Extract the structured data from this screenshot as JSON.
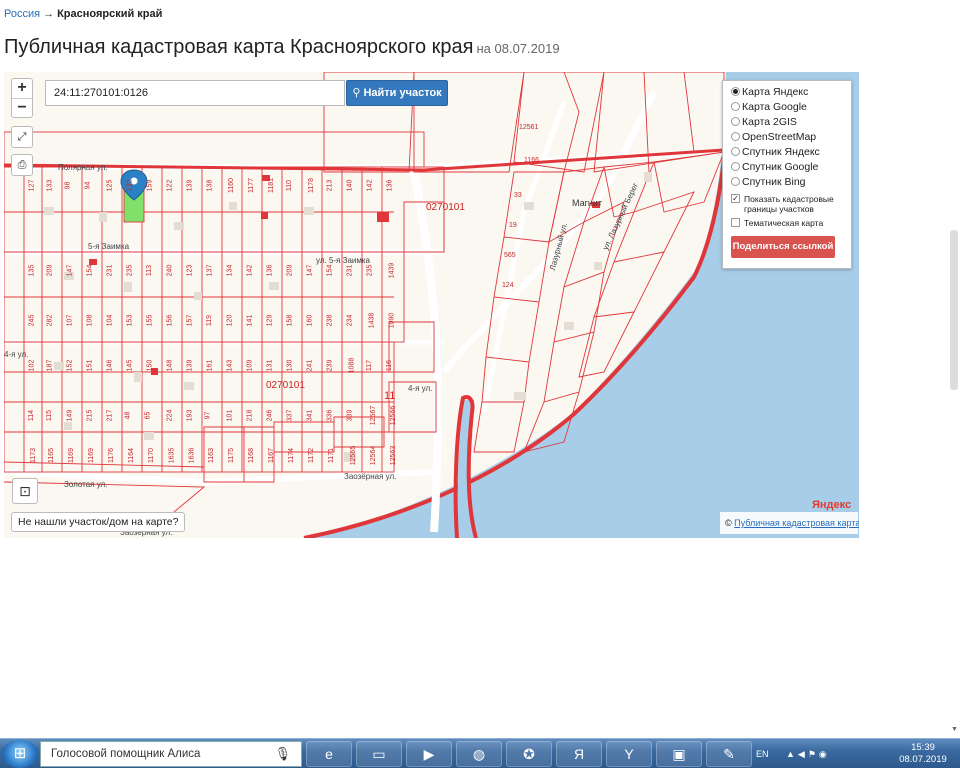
{
  "breadcrumb": {
    "root": "Россия",
    "arrow": "→",
    "current": "Красноярский край"
  },
  "page": {
    "title": "Публичная кадастровая карта Красноярского края",
    "date": "на 08.07.2019"
  },
  "map": {
    "zoom_in": "+",
    "zoom_out": "−",
    "fullscreen_icon": "expand-icon",
    "print_icon": "printer-icon",
    "search": {
      "value": "24:11:270101:0126",
      "button": "Найти участок"
    },
    "layers": [
      {
        "label": "Карта Яндекс",
        "selected": true
      },
      {
        "label": "Карта Google",
        "selected": false
      },
      {
        "label": "Карта 2GIS",
        "selected": false
      },
      {
        "label": "OpenStreetMap",
        "selected": false
      },
      {
        "label": "Спутник Яндекс",
        "selected": false
      },
      {
        "label": "Спутник Google",
        "selected": false
      },
      {
        "label": "Спутник Bing",
        "selected": false
      }
    ],
    "options": [
      {
        "label": "Показать кадастровые границы участков",
        "checked": true
      },
      {
        "label": "Тематическая карта",
        "checked": false
      }
    ],
    "share_button": "Поделиться ссылкой",
    "not_found": "Не нашли участок/дом на карте?",
    "attribution": {
      "prefix": "©",
      "link": "Публичная кадастровая карта"
    },
    "yandex_logo": "Яндекс",
    "labels": {
      "quarter1": "0270101",
      "quarter2": "0270101",
      "street_polyarnaya": "Полярная ул.",
      "street_zaimka5": "5-я Заимка",
      "street_zaimka5b": "ул. 5-я Заимка",
      "street_4ya": "4-я ул.",
      "street_4ya_b": "4-я ул.",
      "street_zaozernaya": "Заозёрная ул.",
      "street_zolotaya": "Золотая ул.",
      "street_zaozernaya_b": "Заозёрная ул.",
      "street_lazurnaya": "Лазурный ул.",
      "street_lazurny_bereg": "ул. Лазурный Берег",
      "magnit": "Магнит",
      "n11": "11"
    },
    "parcel_numbers": [
      "127",
      "133",
      "98",
      "94",
      "125",
      "132",
      "159",
      "122",
      "139",
      "138",
      "1160",
      "1177",
      "1181",
      "110",
      "1178",
      "213",
      "140",
      "142",
      "136",
      "135",
      "209",
      "147",
      "154",
      "231",
      "235",
      "113",
      "240",
      "123",
      "137",
      "134",
      "142",
      "136",
      "209",
      "147",
      "154",
      "231",
      "235",
      "1439",
      "245",
      "282",
      "107",
      "108",
      "104",
      "153",
      "155",
      "156",
      "157",
      "119",
      "120",
      "141",
      "129",
      "158",
      "160",
      "238",
      "234",
      "1438",
      "1090",
      "102",
      "187",
      "152",
      "151",
      "146",
      "145",
      "150",
      "148",
      "139",
      "161",
      "143",
      "109",
      "131",
      "130",
      "241",
      "239",
      "1088",
      "117",
      "116",
      "114",
      "115",
      "149",
      "215",
      "217",
      "48",
      "65",
      "224",
      "193",
      "97",
      "101",
      "218",
      "246",
      "337",
      "341",
      "336",
      "339",
      "12567",
      "12566",
      "1173",
      "1165",
      "1169",
      "1169",
      "1176",
      "1164",
      "1170",
      "1635",
      "1636",
      "1163",
      "1175",
      "1168",
      "1167",
      "1174",
      "1172",
      "1171",
      "12565",
      "12564",
      "12563",
      "12561",
      "1166",
      "33",
      "19",
      "565",
      "124"
    ],
    "colors": {
      "parcel": "#e0363a",
      "water": "#a7cde8",
      "highlight": "#7fe06a",
      "pin": "#2a82c4",
      "road": "#ffffff",
      "bg": "#fbf8f2"
    }
  },
  "taskbar": {
    "alice": "Голосовой помощник Алиса",
    "apps": [
      "ie-icon",
      "folder-icon",
      "media-icon",
      "firefox-icon",
      "game-icon",
      "yandex-icon",
      "yabrowser-icon",
      "window-icon",
      "paint-icon"
    ],
    "lang": "EN",
    "time": "15:39",
    "date": "08.07.2019"
  }
}
